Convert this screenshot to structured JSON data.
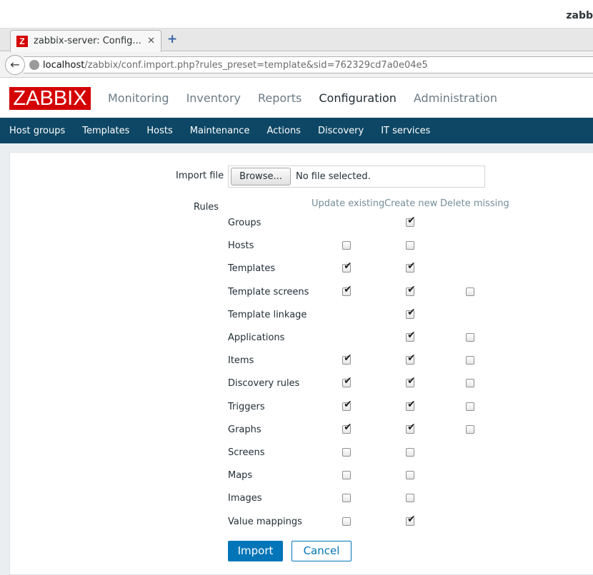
{
  "window": {
    "title": "zabb"
  },
  "browser": {
    "tab_title": "zabbix-server: Config...",
    "tab_close": "✕",
    "new_tab": "+",
    "favicon": "Z",
    "url_host": "localhost",
    "url_path": "/zabbix/conf.import.php?rules_preset=template&sid=762329cd7a0e04e5"
  },
  "header": {
    "logo": "ZABBIX",
    "nav": [
      "Monitoring",
      "Inventory",
      "Reports",
      "Configuration",
      "Administration"
    ],
    "active_nav": "Configuration"
  },
  "subnav": [
    "Host groups",
    "Templates",
    "Hosts",
    "Maintenance",
    "Actions",
    "Discovery",
    "IT services"
  ],
  "form": {
    "import_file_label": "Import file",
    "browse_label": "Browse...",
    "file_status": "No file selected.",
    "rules_label": "Rules",
    "columns": [
      "Update existing",
      "Create new",
      "Delete missing"
    ],
    "rules": [
      {
        "name": "Groups",
        "update": null,
        "create": true,
        "delete": null
      },
      {
        "name": "Hosts",
        "update": false,
        "create": false,
        "delete": null
      },
      {
        "name": "Templates",
        "update": true,
        "create": true,
        "delete": null
      },
      {
        "name": "Template screens",
        "update": true,
        "create": true,
        "delete": false
      },
      {
        "name": "Template linkage",
        "update": null,
        "create": true,
        "delete": null
      },
      {
        "name": "Applications",
        "update": null,
        "create": true,
        "delete": false
      },
      {
        "name": "Items",
        "update": true,
        "create": true,
        "delete": false
      },
      {
        "name": "Discovery rules",
        "update": true,
        "create": true,
        "delete": false
      },
      {
        "name": "Triggers",
        "update": true,
        "create": true,
        "delete": false
      },
      {
        "name": "Graphs",
        "update": true,
        "create": true,
        "delete": false
      },
      {
        "name": "Screens",
        "update": false,
        "create": false,
        "delete": null
      },
      {
        "name": "Maps",
        "update": false,
        "create": false,
        "delete": null
      },
      {
        "name": "Images",
        "update": false,
        "create": false,
        "delete": null
      },
      {
        "name": "Value mappings",
        "update": false,
        "create": true,
        "delete": null
      }
    ],
    "import_label": "Import",
    "cancel_label": "Cancel"
  },
  "colors": {
    "brand_red": "#d40000",
    "nav_blue": "#0e4765",
    "button_blue": "#0275b8"
  }
}
